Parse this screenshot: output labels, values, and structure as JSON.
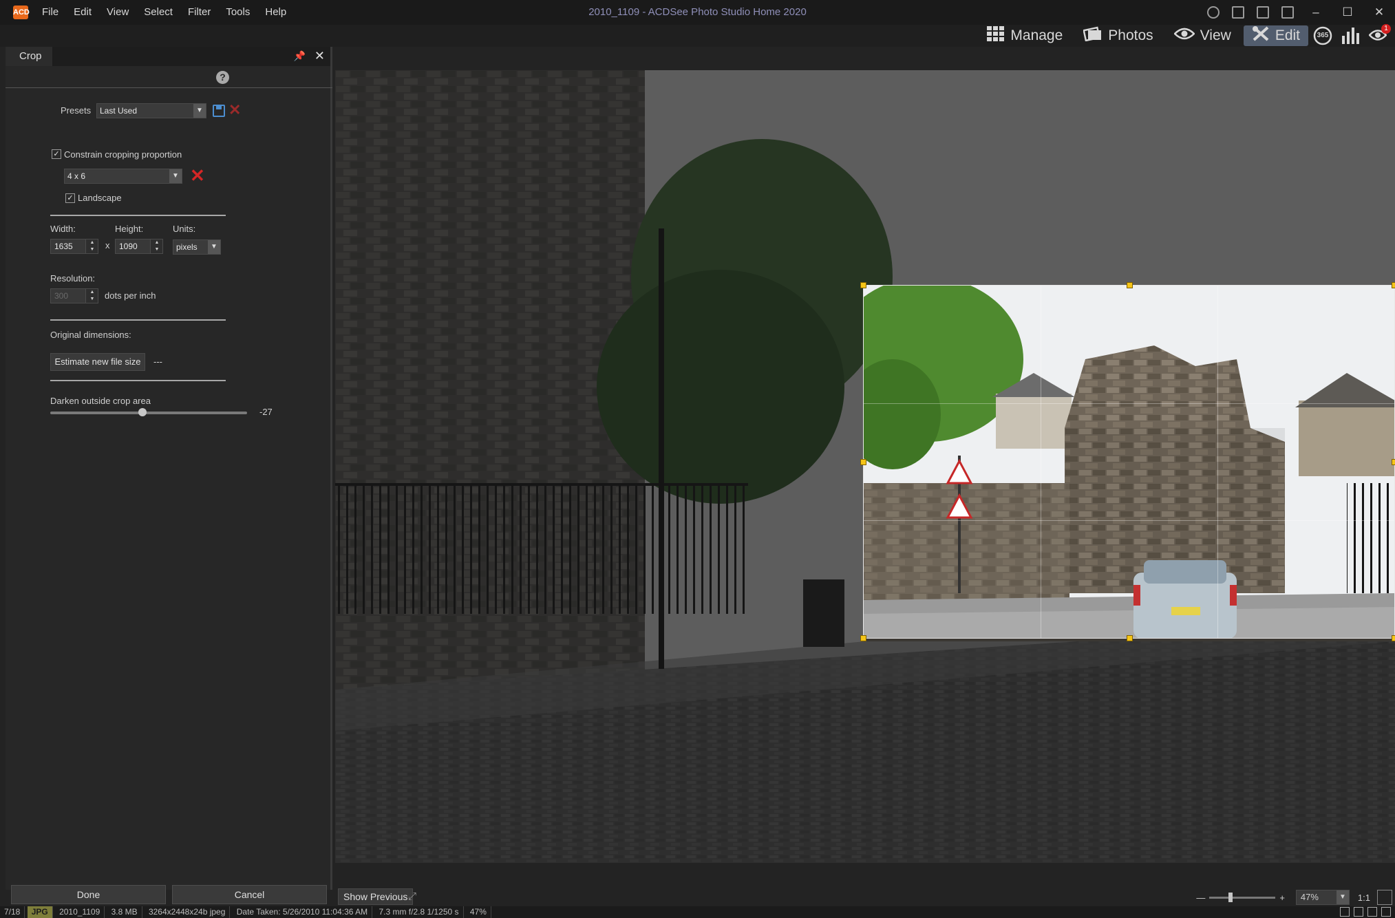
{
  "app": {
    "title": "2010_1109 - ACDSee Photo Studio Home 2020",
    "logo_text": "ACD",
    "menu": [
      "File",
      "Edit",
      "View",
      "Select",
      "Filter",
      "Tools",
      "Help"
    ],
    "window_controls": [
      "–",
      "☐",
      "✕"
    ]
  },
  "modes": {
    "items": [
      {
        "label": "Manage",
        "icon": "grid-icon"
      },
      {
        "label": "Photos",
        "icon": "photos-icon"
      },
      {
        "label": "View",
        "icon": "eye-icon"
      },
      {
        "label": "Edit",
        "icon": "edit-icon",
        "active": true
      }
    ],
    "extra_365": "365",
    "notification_count": "1"
  },
  "panel": {
    "tab": "Crop",
    "presets_label": "Presets",
    "presets_value": "Last Used",
    "constrain_label": "Constrain cropping proportion",
    "constrain_checked": true,
    "ratio_value": "4 x 6",
    "landscape_label": "Landscape",
    "landscape_checked": true,
    "width_label": "Width:",
    "height_label": "Height:",
    "units_label": "Units:",
    "width_value": "1635",
    "height_value": "1090",
    "x_sep": "x",
    "units_value": "pixels",
    "resolution_label": "Resolution:",
    "resolution_value": "300",
    "dpi_label": "dots per inch",
    "original_dimensions_label": "Original dimensions:",
    "estimate_button": "Estimate new file size",
    "estimate_value": "---",
    "darken_label": "Darken outside crop area",
    "darken_value": "-27",
    "darken_level": -27,
    "done_button": "Done",
    "cancel_button": "Cancel"
  },
  "viewer": {
    "show_previous": "Show Previous",
    "zoom_value": "47%",
    "one_to_one": "1:1"
  },
  "status": {
    "index": "7/18",
    "ftype": "JPG",
    "name": "2010_1109",
    "size": "3.8 MB",
    "file_info": "3264x2448x24b jpeg",
    "date_taken": "Date Taken: 5/26/2010 11:04:36 AM",
    "exposure": "7.3 mm   f/2.8   1/1250 s",
    "zoom": "47%"
  },
  "colors": {
    "accent": "#525d6e",
    "crop_handle": "#f5c518",
    "delete_red": "#d52626"
  }
}
